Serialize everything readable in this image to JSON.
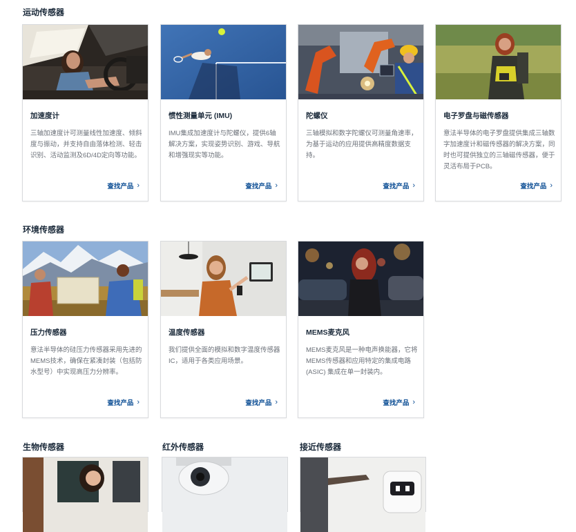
{
  "sections": [
    {
      "title": "运动传感器",
      "cards": [
        {
          "title": "加速度计",
          "desc": "三轴加速度计可测量线性加速度、倾斜度与振动，并支持自由落体检测、轻击识别、活动监测及6D/4D定向等功能。",
          "link": "查找产品"
        },
        {
          "title": "惯性测量单元 (IMU)",
          "desc": "IMU集成加速度计与陀螺仪，提供6轴解决方案，实现姿势识别、游戏、导航和增强现实等功能。",
          "link": "查找产品"
        },
        {
          "title": "陀螺仪",
          "desc": "三轴模拟和数字陀螺仪可测量角速率，为基于运动的应用提供高精度数据支持。",
          "link": "查找产品"
        },
        {
          "title": "电子罗盘与磁传感器",
          "desc": "意法半导体的电子罗盘提供集成三轴数字加速度计和磁传感器的解决方案，同时也可提供独立的三轴磁传感器，便于灵活布局于PCB。",
          "link": "查找产品"
        }
      ]
    },
    {
      "title": "环境传感器",
      "cards": [
        {
          "title": "压力传感器",
          "desc": "意法半导体的硅压力传感器采用先进的MEMS技术，确保在紧凑封装（包括防水型号）中实现高压力分辨率。",
          "link": "查找产品"
        },
        {
          "title": "温度传感器",
          "desc": "我们提供全面的模拟和数字温度传感器IC，适用于各类应用场景。",
          "link": "查找产品"
        },
        {
          "title": "MEMS麦克风",
          "desc": "MEMS麦克风是一种电声换能器，它将MEMS传感器和应用特定的集成电路 (ASIC) 集成在单一封装内。",
          "link": "查找产品"
        }
      ]
    }
  ],
  "bottom_sections": [
    {
      "title": "生物传感器"
    },
    {
      "title": "红外传感器"
    },
    {
      "title": "接近传感器"
    }
  ],
  "colors": {
    "link": "#0b4d94",
    "title": "#1b2a3a",
    "desc": "#6b7078",
    "border": "#d8dadd"
  },
  "icons": {
    "link_arrow": "chevron-right-icon"
  }
}
